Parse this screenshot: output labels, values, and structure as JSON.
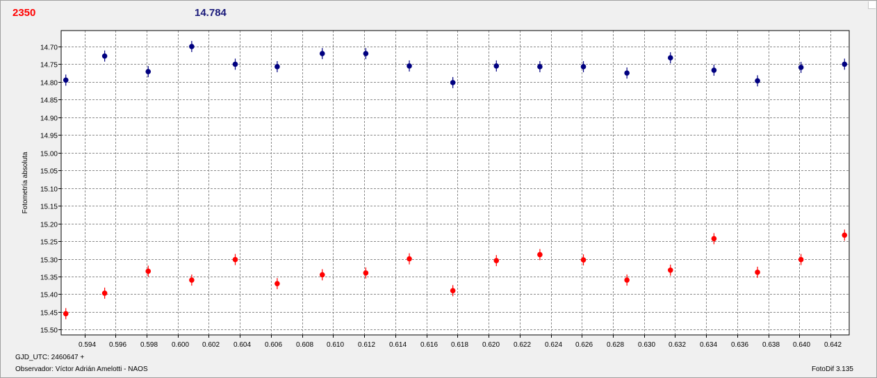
{
  "header": {
    "left_value": "2350",
    "right_value": "14.784"
  },
  "footer": {
    "gjd": "GJD_UTC: 2460647 +",
    "observer": "Observador: Víctor Adrián Amelotti - NAOS",
    "version": "FotoDif 3.135"
  },
  "colors": {
    "series_target": "#ff0000",
    "series_comparison": "#000080",
    "grid": "#888888",
    "plot_background": "#ffffff"
  },
  "chart_data": {
    "type": "scatter",
    "title": "",
    "xlabel": "",
    "ylabel": "Fotometría absoluta",
    "xlim": [
      0.5925,
      0.6432
    ],
    "ylim": [
      15.515,
      14.655
    ],
    "y_inverted": true,
    "grid": true,
    "xticks": [
      "0.594",
      "0.596",
      "0.598",
      "0.600",
      "0.602",
      "0.604",
      "0.606",
      "0.608",
      "0.610",
      "0.612",
      "0.614",
      "0.616",
      "0.618",
      "0.620",
      "0.622",
      "0.624",
      "0.626",
      "0.628",
      "0.630",
      "0.632",
      "0.634",
      "0.636",
      "0.638",
      "0.640",
      "0.642"
    ],
    "yticks": [
      "14.70",
      "14.75",
      "14.80",
      "14.85",
      "14.90",
      "14.95",
      "15.00",
      "15.05",
      "15.10",
      "15.15",
      "15.20",
      "15.25",
      "15.30",
      "15.35",
      "15.40",
      "15.45",
      "15.50"
    ],
    "series": [
      {
        "color": "#000080",
        "points": [
          [
            0.5928,
            14.795
          ],
          [
            0.5953,
            14.727
          ],
          [
            0.5981,
            14.771
          ],
          [
            0.6009,
            14.7
          ],
          [
            0.6037,
            14.75
          ],
          [
            0.6064,
            14.757
          ],
          [
            0.6093,
            14.72
          ],
          [
            0.6121,
            14.72
          ],
          [
            0.6149,
            14.755
          ],
          [
            0.6177,
            14.802
          ],
          [
            0.6205,
            14.755
          ],
          [
            0.6233,
            14.757
          ],
          [
            0.6261,
            14.757
          ],
          [
            0.6289,
            14.775
          ],
          [
            0.6317,
            14.732
          ],
          [
            0.6345,
            14.767
          ],
          [
            0.6373,
            14.797
          ],
          [
            0.6401,
            14.759
          ],
          [
            0.6429,
            14.75
          ]
        ]
      },
      {
        "color": "#ff0000",
        "points": [
          [
            0.5928,
            15.455
          ],
          [
            0.5953,
            15.397
          ],
          [
            0.5981,
            15.335
          ],
          [
            0.6009,
            15.36
          ],
          [
            0.6037,
            15.302
          ],
          [
            0.6064,
            15.37
          ],
          [
            0.6093,
            15.345
          ],
          [
            0.6121,
            15.34
          ],
          [
            0.6149,
            15.3
          ],
          [
            0.6177,
            15.39
          ],
          [
            0.6205,
            15.305
          ],
          [
            0.6233,
            15.288
          ],
          [
            0.6261,
            15.303
          ],
          [
            0.6289,
            15.36
          ],
          [
            0.6317,
            15.332
          ],
          [
            0.6345,
            15.243
          ],
          [
            0.6373,
            15.338
          ],
          [
            0.6401,
            15.302
          ],
          [
            0.6429,
            15.233
          ]
        ]
      }
    ]
  }
}
